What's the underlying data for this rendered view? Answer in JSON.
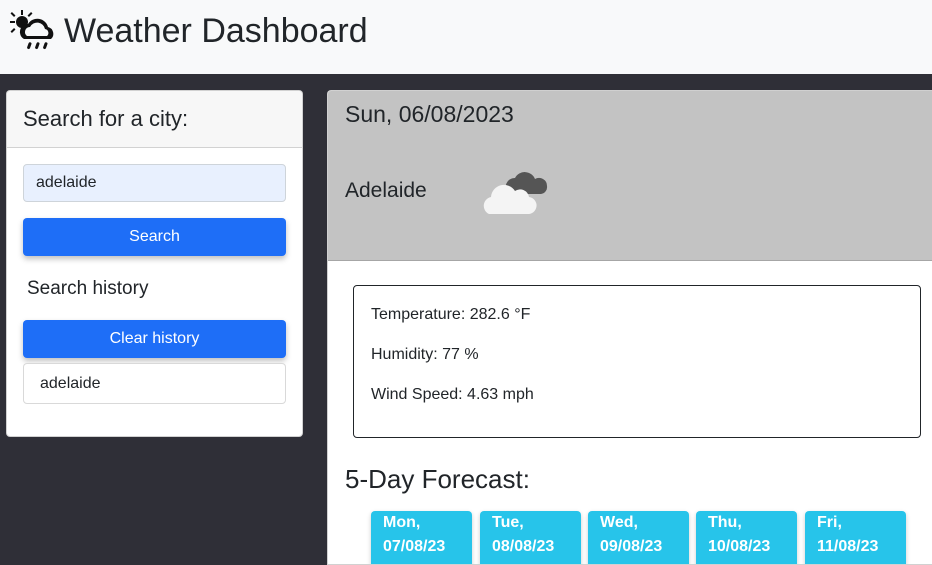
{
  "header": {
    "title": "Weather Dashboard",
    "icon": "cloud-sun-rain-icon"
  },
  "search": {
    "heading": "Search for a city:",
    "input_value": "adelaide",
    "button_label": "Search"
  },
  "history": {
    "heading": "Search history",
    "clear_label": "Clear history",
    "items": [
      {
        "label": "adelaide"
      }
    ]
  },
  "current": {
    "date": "Sun, 06/08/2023",
    "city": "Adelaide",
    "icon": "cloud-icon",
    "temperature": "Temperature: 282.6 °F",
    "humidity": "Humidity: 77 %",
    "wind": "Wind Speed: 4.63 mph"
  },
  "forecast": {
    "title": "5-Day Forecast:",
    "days": [
      {
        "day": "Mon,",
        "date": "07/08/23"
      },
      {
        "day": "Tue,",
        "date": "08/08/23"
      },
      {
        "day": "Wed,",
        "date": "09/08/23"
      },
      {
        "day": "Thu,",
        "date": "10/08/23"
      },
      {
        "day": "Fri,",
        "date": "11/08/23"
      }
    ]
  },
  "colors": {
    "primary_button": "#1e6ef7",
    "forecast_card": "#27c4ea",
    "page_background": "#2f2f37",
    "current_header": "#c3c3c3"
  }
}
